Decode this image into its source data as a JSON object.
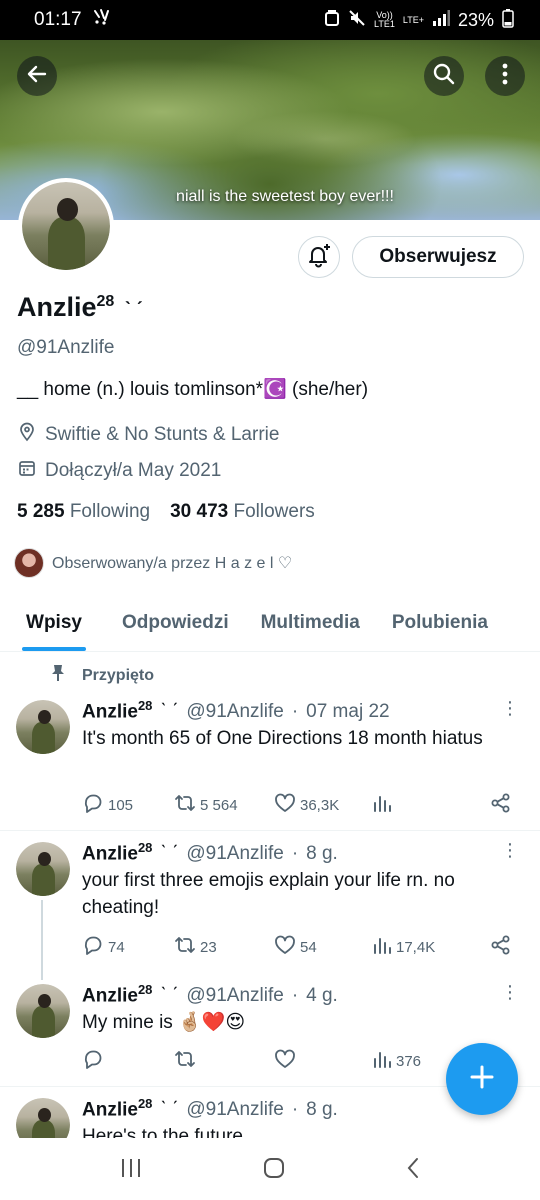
{
  "status_bar": {
    "time": "01:17",
    "network_top": "Vo))",
    "network_bottom": "LTE1",
    "lte": "LTE+",
    "battery": "23%"
  },
  "banner": {
    "caption": "niall is the sweetest boy ever!!!"
  },
  "profile": {
    "follow_label": "Obserwujesz",
    "name": "Anzlie",
    "name_sup": "28",
    "name_emoticon": "ˋ ˊ",
    "handle": "@91Anzlife",
    "bio": "__ home (n.) louis tomlinson*☪️ (she/her)",
    "location": "Swiftie & No Stunts & Larrie",
    "joined": "Dołączył/a May 2021",
    "following_count": "5 285",
    "following_label": "Following",
    "followers_count": "30 473",
    "followers_label": "Followers",
    "followed_by": "Obserwowany/a przez H a z e l ♡"
  },
  "tabs": [
    {
      "label": "Wpisy"
    },
    {
      "label": "Odpowiedzi"
    },
    {
      "label": "Multimedia"
    },
    {
      "label": "Polubienia"
    }
  ],
  "pinned_label": "Przypięto",
  "tweets": [
    {
      "name": "Anzlie",
      "sup": "28",
      "emo": "ˋ ˊ",
      "handle": "@91Anzlife",
      "sep": "·",
      "time": "07 maj 22",
      "text": "It's month 65 of One Directions 18 month hiatus",
      "replies": "105",
      "retweets": "5 564",
      "likes": "36,3K",
      "views": ""
    },
    {
      "name": "Anzlie",
      "sup": "28",
      "emo": "ˋ ˊ",
      "handle": "@91Anzlife",
      "sep": "·",
      "time": "8 g.",
      "text": "your first three emojis explain your life rn. no cheating!",
      "replies": "74",
      "retweets": "23",
      "likes": "54",
      "views": "17,4K"
    },
    {
      "name": "Anzlie",
      "sup": "28",
      "emo": "ˋ ˊ",
      "handle": "@91Anzlife",
      "sep": "·",
      "time": "4 g.",
      "text": "My mine is 🤞🏼❤️😍",
      "replies": "",
      "retweets": "",
      "likes": "",
      "views": "376"
    },
    {
      "name": "Anzlie",
      "sup": "28",
      "emo": "ˋ ˊ",
      "handle": "@91Anzlife",
      "sep": "·",
      "time": "8 g.",
      "text": "Here's to the future",
      "replies": "",
      "retweets": "",
      "likes": "",
      "views": ""
    }
  ],
  "colors": {
    "accent": "#1d9bf0",
    "text": "#0f1419",
    "muted": "#536471",
    "border": "#cfd9de"
  },
  "icons": [
    "back-arrow-icon",
    "search-icon",
    "more-vertical-icon",
    "bell-plus-icon",
    "location-pin-icon",
    "calendar-icon",
    "pin-icon",
    "reply-icon",
    "retweet-icon",
    "like-icon",
    "views-icon",
    "share-icon",
    "compose-plus-icon",
    "recents-icon",
    "home-icon",
    "back-nav-icon"
  ]
}
